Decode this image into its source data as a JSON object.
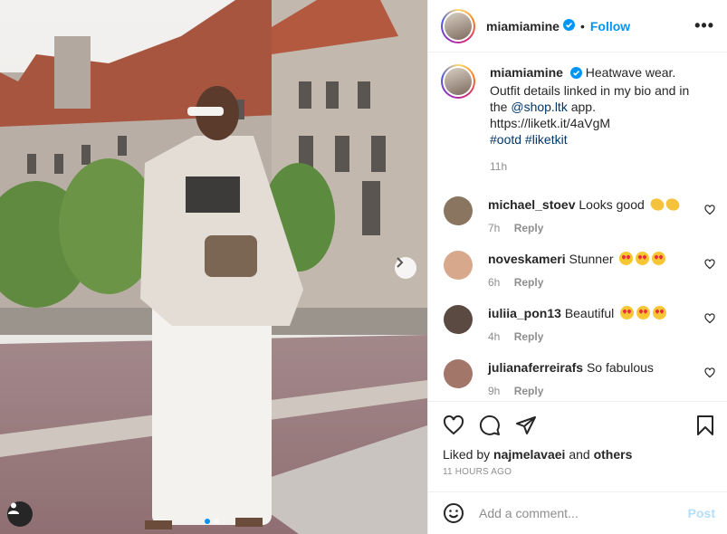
{
  "post": {
    "username": "miamiamine",
    "follow_label": "Follow",
    "separator": "•",
    "more_label": "•••",
    "caption_text": "Heatwave wear. Outfit details linked in my bio and in the",
    "caption_mention": "@shop.ltk",
    "caption_rest": "app. https://liketk.it/4aVgM",
    "caption_tags": "#ootd #liketkit",
    "caption_time": "11h"
  },
  "comments": [
    {
      "user": "michael_stoev",
      "text": "Looks good",
      "emoji": "clap",
      "time": "7h",
      "reply": "Reply",
      "avatar_color": "#8a7560"
    },
    {
      "user": "noveskameri",
      "text": "Stunner",
      "emoji": "love",
      "time": "6h",
      "reply": "Reply",
      "avatar_color": "#d8a88c"
    },
    {
      "user": "iuliia_pon13",
      "text": "Beautiful",
      "emoji": "love",
      "time": "4h",
      "reply": "Reply",
      "avatar_color": "#5b4a42"
    },
    {
      "user": "julianaferreirafs",
      "text": "So fabulous",
      "emoji": "",
      "time": "9h",
      "reply": "Reply",
      "avatar_color": "#a3766a"
    }
  ],
  "likes": {
    "prefix": "Liked by",
    "user": "najmelavaei",
    "and": "and",
    "others": "others",
    "ago": "11 HOURS AGO"
  },
  "add_comment": {
    "placeholder": "Add a comment...",
    "post_label": "Post"
  },
  "icons": {
    "verified": "verified-badge-icon",
    "heart": "heart-icon",
    "comment": "comment-icon",
    "share": "share-icon",
    "save": "bookmark-icon",
    "emoji": "emoji-icon",
    "next": "chevron-right-icon",
    "tag": "user-tag-icon"
  },
  "colors": {
    "accent": "#0095f6",
    "verified": "#0095f6",
    "link": "#00376b"
  }
}
